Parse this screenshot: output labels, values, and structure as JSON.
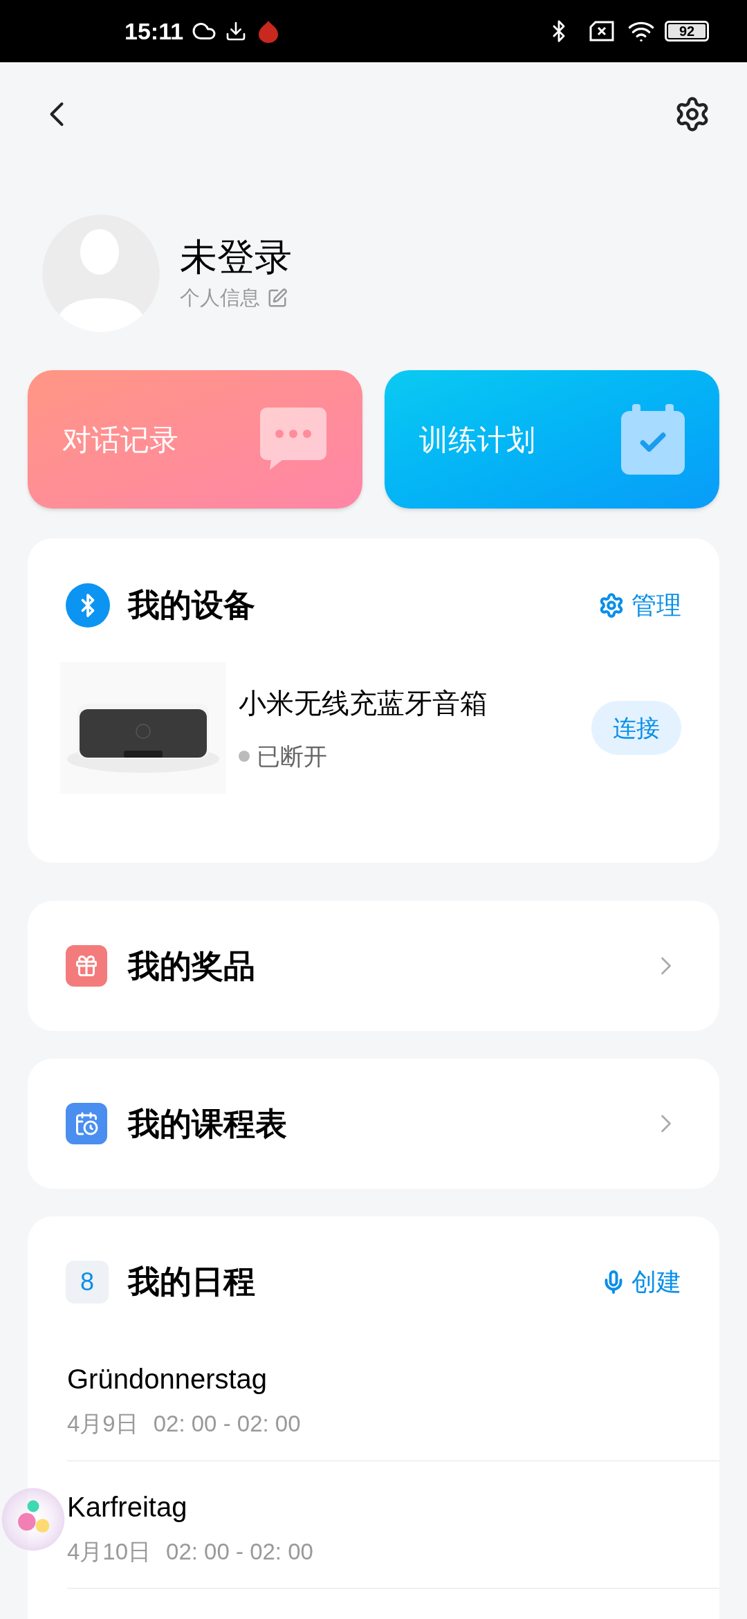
{
  "status_bar": {
    "time": "15:11",
    "battery": "92"
  },
  "profile": {
    "name": "未登录",
    "subtitle": "个人信息"
  },
  "shortcuts": [
    {
      "label": "对话记录",
      "kind": "chat"
    },
    {
      "label": "训练计划",
      "kind": "plan"
    }
  ],
  "devices": {
    "title": "我的设备",
    "action": "管理",
    "items": [
      {
        "name": "小米无线充蓝牙音箱",
        "status": "已断开",
        "connected": false,
        "button": "连接"
      }
    ]
  },
  "menu": [
    {
      "label": "我的奖品",
      "kind": "gift"
    },
    {
      "label": "我的课程表",
      "kind": "course"
    }
  ],
  "schedule": {
    "day": "8",
    "title": "我的日程",
    "action": "创建",
    "events": [
      {
        "title": "Gründonnerstag",
        "date": "4月9日",
        "time": "02: 00 - 02: 00"
      },
      {
        "title": "Karfreitag",
        "date": "4月10日",
        "time": "02: 00 - 02: 00"
      }
    ]
  }
}
